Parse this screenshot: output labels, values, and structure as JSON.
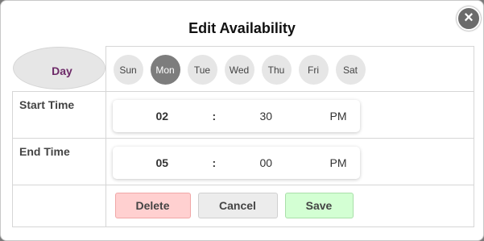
{
  "dialog": {
    "title": "Edit Availability",
    "close_icon": "close-icon"
  },
  "day_row": {
    "label": "Day",
    "days": [
      "Sun",
      "Mon",
      "Tue",
      "Wed",
      "Thu",
      "Fri",
      "Sat"
    ],
    "selected": "Mon"
  },
  "start_time": {
    "label": "Start Time",
    "hour": "02",
    "separator": ":",
    "minute": "30",
    "period": "PM"
  },
  "end_time": {
    "label": "End Time",
    "hour": "05",
    "separator": ":",
    "minute": "00",
    "period": "PM"
  },
  "actions": {
    "delete_label": "Delete",
    "cancel_label": "Cancel",
    "save_label": "Save"
  },
  "colors": {
    "day_label": "#6d2a68",
    "selected_day": "#7d7d7d",
    "delete_bg": "#ffd0d0",
    "save_bg": "#d3ffd3"
  }
}
